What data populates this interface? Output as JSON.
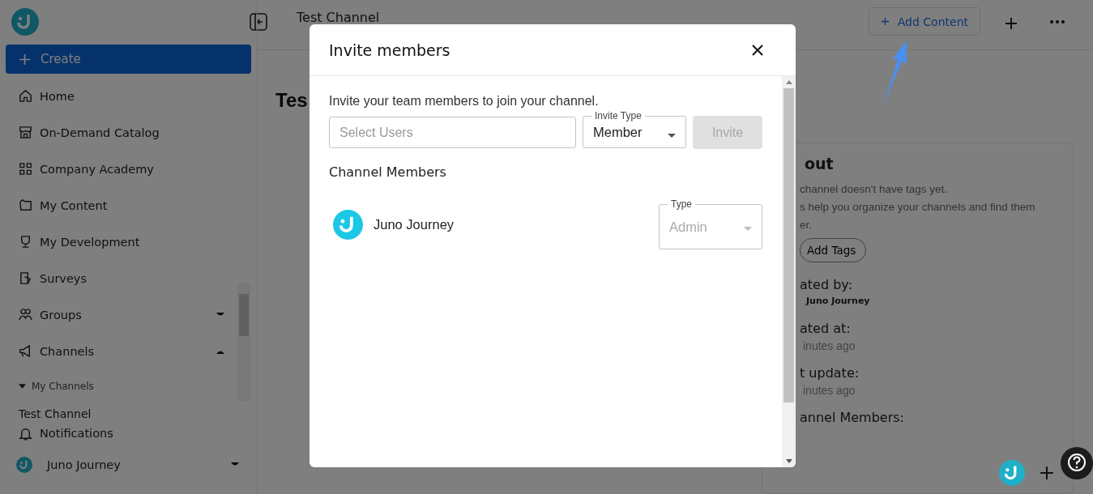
{
  "sidebar": {
    "create_button": "Create",
    "items": [
      {
        "label": "Home",
        "kind": "link"
      },
      {
        "label": "On-Demand Catalog",
        "kind": "link"
      },
      {
        "label": "Company Academy",
        "kind": "link"
      },
      {
        "label": "My Content",
        "kind": "link"
      },
      {
        "label": "My Development",
        "kind": "link"
      },
      {
        "label": "Surveys",
        "kind": "link"
      },
      {
        "label": "Groups",
        "kind": "group",
        "expanded": false
      },
      {
        "label": "Channels",
        "kind": "group",
        "expanded": true,
        "children": [
          {
            "label": "My Channels",
            "expanded": true,
            "children": [
              {
                "label": "Test Channel"
              }
            ]
          }
        ]
      }
    ],
    "notifications": "Notifications",
    "user": {
      "name": "Juno Journey",
      "expanded": false
    }
  },
  "topbar": {
    "title": "Test Channel",
    "add_content": "Add Content"
  },
  "page_title": "Tes",
  "about": {
    "title": "out",
    "lines": [
      "channel doesn't have tags yet.",
      "s help you organize your channels and find them",
      "er."
    ],
    "add_tags": "Add Tags",
    "fields": [
      {
        "label": "ated by:",
        "value": "Juno Journey",
        "kind": "user"
      },
      {
        "label": "ated at:",
        "value": "inutes ago",
        "kind": "time"
      },
      {
        "label": "t update:",
        "value": "inutes ago",
        "kind": "time"
      },
      {
        "label": "annel Members:",
        "kind": "heading"
      }
    ]
  },
  "modal": {
    "title": "Invite members",
    "intro": "Invite your team members to join your channel.",
    "select_users": {
      "placeholder": "Select Users"
    },
    "invite_type": {
      "label": "Invite Type",
      "value": "Member"
    },
    "invite_button": {
      "label": "Invite",
      "disabled": true
    },
    "members_heading": "Channel Members",
    "members": [
      {
        "name": "Juno Journey",
        "type_label": "Type",
        "type": "Admin",
        "disabled": true
      }
    ]
  }
}
